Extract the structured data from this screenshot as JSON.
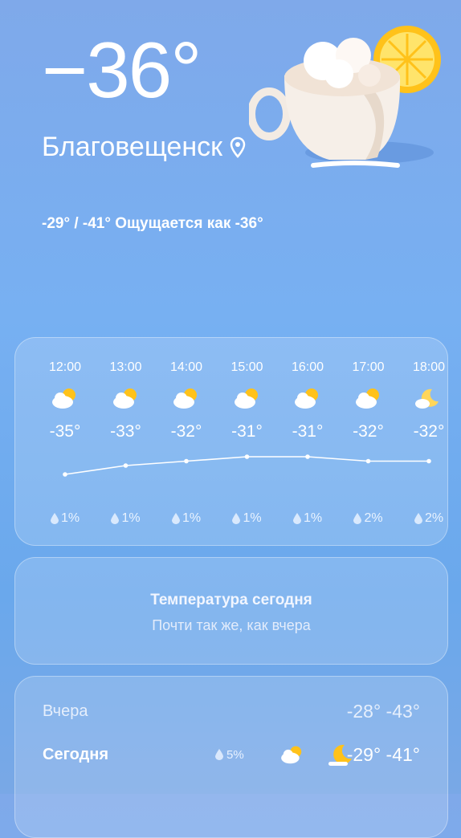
{
  "current": {
    "temperature": "−36°",
    "city": "Благовещенск",
    "summary": "-29° / -41° Ощущается как -36°"
  },
  "hourly": [
    {
      "time": "12:00",
      "temp": "-35°",
      "value": -35,
      "precip": "1%",
      "icon": "partly-cloudy-icon"
    },
    {
      "time": "13:00",
      "temp": "-33°",
      "value": -33,
      "precip": "1%",
      "icon": "partly-cloudy-icon"
    },
    {
      "time": "14:00",
      "temp": "-32°",
      "value": -32,
      "precip": "1%",
      "icon": "partly-cloudy-icon"
    },
    {
      "time": "15:00",
      "temp": "-31°",
      "value": -31,
      "precip": "1%",
      "icon": "partly-cloudy-icon"
    },
    {
      "time": "16:00",
      "temp": "-31°",
      "value": -31,
      "precip": "1%",
      "icon": "partly-cloudy-icon"
    },
    {
      "time": "17:00",
      "temp": "-32°",
      "value": -32,
      "precip": "2%",
      "icon": "partly-cloudy-icon"
    },
    {
      "time": "18:00",
      "temp": "-32°",
      "value": -32,
      "precip": "2%",
      "icon": "moon-cloud-icon"
    }
  ],
  "today_card": {
    "title": "Температура сегодня",
    "subtitle": "Почти так же, как вчера"
  },
  "daily": [
    {
      "day": "Вчера",
      "pct": "",
      "temps": "-28° -43°",
      "icons": []
    },
    {
      "day": "Сегодня",
      "pct": "5%",
      "temps": "-29° -41°",
      "icons": [
        "partly-cloudy-icon",
        "moon-icon"
      ]
    }
  ],
  "colors": {
    "background_top": "#7fa9ea",
    "background_bottom": "#6aa8ec",
    "sun": "#ffc21a"
  }
}
